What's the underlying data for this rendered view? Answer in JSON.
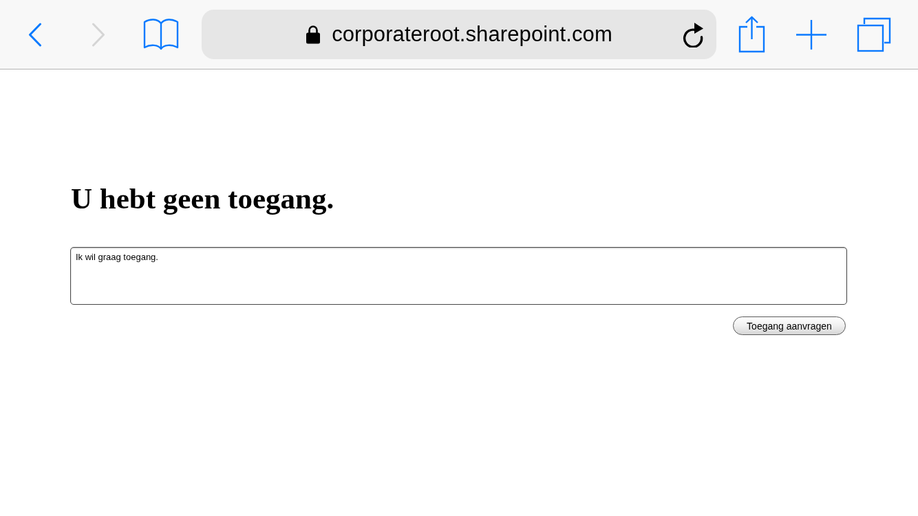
{
  "toolbar": {
    "back_button": {
      "disabled": false
    },
    "forward_button": {
      "disabled": true
    },
    "address_bar": {
      "url": "corporateroot.sharepoint.com"
    }
  },
  "page": {
    "heading": "U hebt geen toegang.",
    "message_field": {
      "value": "Ik wil graag toegang."
    },
    "submit_button": {
      "label": "Toegang aanvragen"
    }
  }
}
